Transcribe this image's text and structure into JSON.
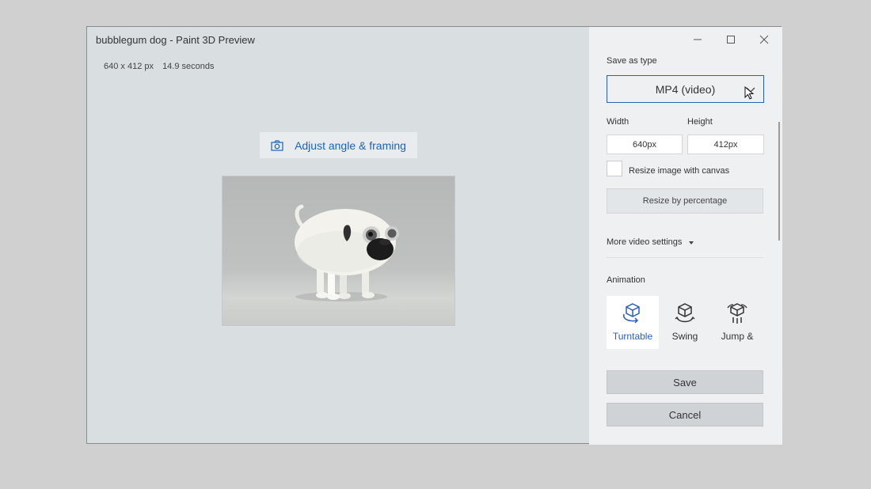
{
  "window": {
    "title": "bubblegum dog - Paint 3D Preview"
  },
  "info": {
    "dimensions": "640 x 412 px",
    "duration": "14.9 seconds"
  },
  "adjust_button": {
    "label": "Adjust angle & framing",
    "icon": "camera-icon"
  },
  "controls": {
    "minimize": "minimize-icon",
    "maximize": "maximize-icon",
    "close": "close-icon"
  },
  "panel": {
    "save_type_label": "Save as type",
    "save_type_value": "MP4 (video)",
    "width_label": "Width",
    "height_label": "Height",
    "width_value": "640px",
    "height_value": "412px",
    "resize_canvas_label": "Resize image with canvas",
    "resize_canvas_checked": false,
    "resize_percentage_label": "Resize by percentage",
    "more_settings_label": "More video settings",
    "animation_label": "Animation",
    "animations": [
      {
        "label": "Turntable",
        "icon": "turntable-icon",
        "selected": true
      },
      {
        "label": "Swing",
        "icon": "swing-icon",
        "selected": false
      },
      {
        "label": "Jump &",
        "icon": "jump-icon",
        "selected": false
      }
    ],
    "save_label": "Save",
    "cancel_label": "Cancel"
  },
  "colors": {
    "accent": "#2a5fb5",
    "link": "#1e63b3",
    "pane": "#d9dee1",
    "panel": "#eef0f2"
  }
}
